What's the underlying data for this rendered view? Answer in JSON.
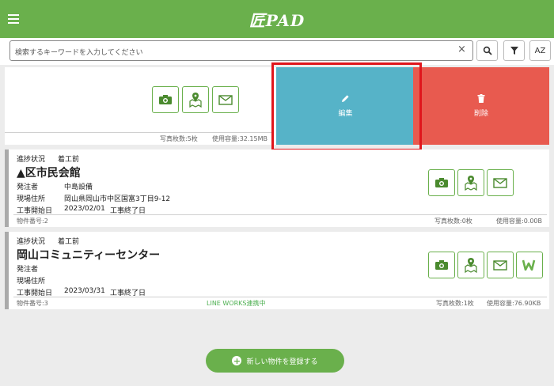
{
  "header": {
    "logo": "匠PAD"
  },
  "search": {
    "placeholder": "検索するキーワードを入力してください",
    "clear": "×",
    "sort_label": "AZ"
  },
  "swiped_item": {
    "photo_count": "写真枚数:5枚",
    "storage": "使用容量:32.15MB",
    "edit_label": "編集",
    "delete_label": "削除"
  },
  "items": [
    {
      "status_label": "進捗状況",
      "status": "着工前",
      "name": "▲区市民会館",
      "client_label": "発注者",
      "client": "中島設備",
      "site_label": "現場住所",
      "site": "岡山県岡山市中区国富3丁目9-12",
      "start_label": "工事開始日",
      "start": "2023/02/01",
      "end": "工事終了日",
      "number": "物件番号:2",
      "photo_count": "写真枚数:0枚",
      "storage": "使用容量:0.00B"
    },
    {
      "status_label": "進捗状況",
      "status": "着工前",
      "name": "岡山コミュニティーセンター",
      "client_label": "発注者",
      "client": "",
      "site_label": "現場住所",
      "site": "",
      "start_label": "工事開始日",
      "start": "2023/03/31",
      "end": "工事終了日",
      "number": "物件番号:3",
      "lineworks": "LINE WORKS連携中",
      "photo_count": "写真枚数:1枚",
      "storage": "使用容量:76.90KB"
    }
  ],
  "register_button": {
    "plus": "+",
    "label": "新しい物件を登録する"
  },
  "colors": {
    "brand": "#6ab04c",
    "edit": "#56b3c8",
    "delete": "#e85a4f",
    "highlight": "#e0161c"
  }
}
